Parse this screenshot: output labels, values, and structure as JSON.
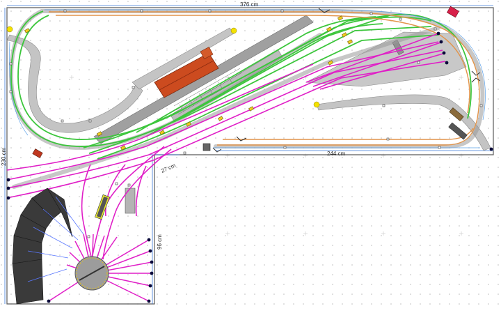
{
  "dimensions": {
    "top_width": "376 cm",
    "left_height": "230 cm",
    "inner_width": "244 cm",
    "inner_step": "27 cm",
    "inner_height": "96 cm"
  },
  "colors": {
    "background": "#ffffff",
    "grid_dot": "#bcbcbc",
    "baseboard_line": "#5a5a5a",
    "dimension_line": "#3a78d8",
    "platform": "#c4c4c4",
    "station_building": "#cc4b1f",
    "track_sleeper": "#9a9a9a",
    "track_green": "#3cc63c",
    "track_orange": "#e2944a",
    "track_magenta": "#e01fc7",
    "track_blue_rail": "#5aa0e8",
    "turntable": "#9c9c9c",
    "roundhouse": "#3a3a3a",
    "bumper": "#0a0a3a",
    "signal": "#f0cc20",
    "end_marker": "#f4e200"
  },
  "layer_names": [
    "green-mainline",
    "orange-mainline",
    "magenta-yard",
    "blue-rails"
  ]
}
